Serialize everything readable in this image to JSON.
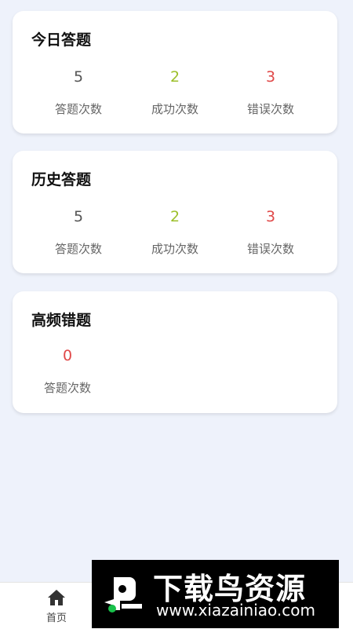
{
  "colors": {
    "background": "#eef2fb",
    "neutral": "#555555",
    "success": "#9cbf2a",
    "error": "#e04848"
  },
  "today": {
    "title": "今日答题",
    "stats": [
      {
        "value": "5",
        "label": "答题次数"
      },
      {
        "value": "2",
        "label": "成功次数"
      },
      {
        "value": "3",
        "label": "错误次数"
      }
    ]
  },
  "history": {
    "title": "历史答题",
    "stats": [
      {
        "value": "5",
        "label": "答题次数"
      },
      {
        "value": "2",
        "label": "成功次数"
      },
      {
        "value": "3",
        "label": "错误次数"
      }
    ]
  },
  "frequent": {
    "title": "高频错题",
    "stats": [
      {
        "value": "0",
        "label": "答题次数"
      }
    ]
  },
  "tabbar": {
    "home_label": "首页",
    "home_icon": "home-icon"
  },
  "watermark": {
    "title": "下载鸟资源",
    "url": "www.xiazainiao.com",
    "logo_icon": "bird-logo-icon"
  }
}
